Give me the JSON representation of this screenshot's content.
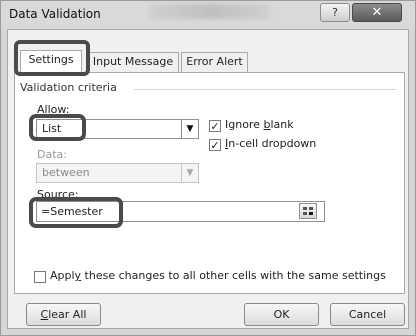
{
  "window": {
    "title": "Data Validation",
    "help_label": "?",
    "close_label": "✕"
  },
  "tabs": [
    {
      "label": "Settings",
      "selected": true
    },
    {
      "label": "Input Message",
      "selected": false
    },
    {
      "label": "Error Alert",
      "selected": false
    }
  ],
  "settings": {
    "group_label": "Validation criteria",
    "allow": {
      "label": "Allow:",
      "value": "List"
    },
    "data": {
      "label": "Data:",
      "value": "between",
      "disabled": true
    },
    "ignore_blank": {
      "label": "Ignore blank",
      "checked": true
    },
    "in_cell_dropdown": {
      "label": "In-cell dropdown",
      "checked": true
    },
    "source": {
      "label": "Source:",
      "value": "=Semester"
    },
    "apply_all": {
      "label": "Apply these changes to all other cells with the same settings",
      "checked": false
    }
  },
  "buttons": {
    "clear_all": "Clear All",
    "ok": "OK",
    "cancel": "Cancel"
  },
  "icons": {
    "dropdown": "chevron-down-icon",
    "checkmark": "checkmark-icon",
    "range_select": "range-select-icon"
  },
  "colors": {
    "highlight_border": "#4a4a4a",
    "dialog_bg": "#f0f0f0",
    "panel_bg": "#ffffff"
  }
}
